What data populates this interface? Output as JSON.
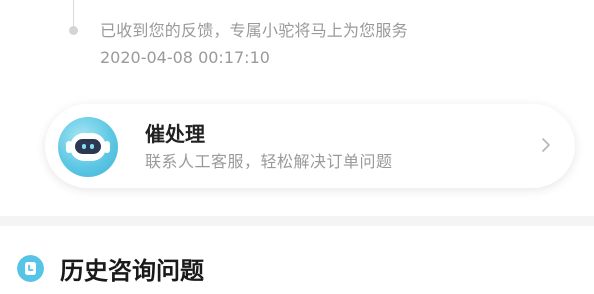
{
  "timeline": {
    "message": "已收到您的反馈，专属小驼将马上为您服务",
    "timestamp": "2020-04-08 00:17:10"
  },
  "urge_card": {
    "title": "催处理",
    "subtitle": "联系人工客服，轻松解决订单问题",
    "icon": "robot-avatar-icon",
    "arrow_icon": "chevron-right-icon"
  },
  "history": {
    "title": "历史咨询问题",
    "icon": "clock-icon"
  },
  "colors": {
    "accent": "#55c4e6",
    "muted_text": "#9a9a9a",
    "title_text": "#222222"
  }
}
